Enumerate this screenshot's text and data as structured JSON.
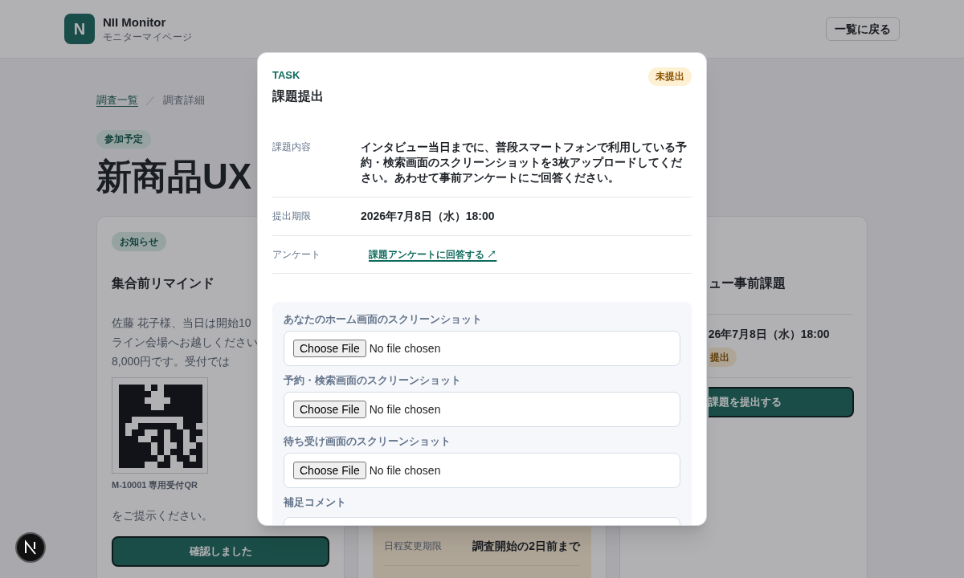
{
  "header": {
    "logo": "N",
    "title": "NII Monitor",
    "subtitle": "モニターマイページ",
    "back_button": "一覧に戻る"
  },
  "breadcrumb": {
    "items": [
      {
        "label": "調査一覧",
        "kind": "link"
      },
      {
        "label": "調査詳細",
        "kind": "current"
      }
    ],
    "separator": "／"
  },
  "survey": {
    "status": "参加予定",
    "title": "新商品UX"
  },
  "cards": [
    {
      "kind": "notice",
      "badge": "お知らせ",
      "title": "集合前リマインド",
      "message_lines": [
        "佐藤 花子様、当日は開始10",
        "ライン会場へお越しください",
        "8,000円です。受付では"
      ],
      "qr_caption": "M-10001 専用受付QR",
      "message_end": "をご提示ください。",
      "button": "確認しました"
    },
    {
      "kind": "schedule",
      "rows": [
        {
          "label": "日程変更期限",
          "value": "調査開始の2日前まで"
        }
      ]
    },
    {
      "kind": "task",
      "title": "ュー事前課題",
      "deadline": "26年7月8日（水）18:00",
      "status": "提出",
      "button": "課題を提出する"
    }
  ],
  "modal": {
    "eyebrow": "TASK",
    "title": "課題提出",
    "status": "未提出",
    "details": [
      {
        "label": "課題内容",
        "kind": "text",
        "value": "インタビュー当日までに、普段スマートフォンで利用している予約・検索画面のスクリーンショットを3枚アップロードしてください。あわせて事前アンケートにご回答ください。"
      },
      {
        "label": "提出期限",
        "kind": "text",
        "value": "2026年7月8日（水）18:00"
      },
      {
        "label": "アンケート",
        "kind": "link",
        "value": "課題アンケートに回答する ↗"
      }
    ],
    "uploads": [
      {
        "label": "あなたのホーム画面のスクリーンショット",
        "button": "Choose File",
        "status": "No file chosen"
      },
      {
        "label": "予約・検索画面のスクリーンショット",
        "button": "Choose File",
        "status": "No file chosen"
      },
      {
        "label": "待ち受け画面のスクリーンショット",
        "button": "Choose File",
        "status": "No file chosen"
      }
    ],
    "comment": {
      "label": "補足コメント"
    }
  }
}
